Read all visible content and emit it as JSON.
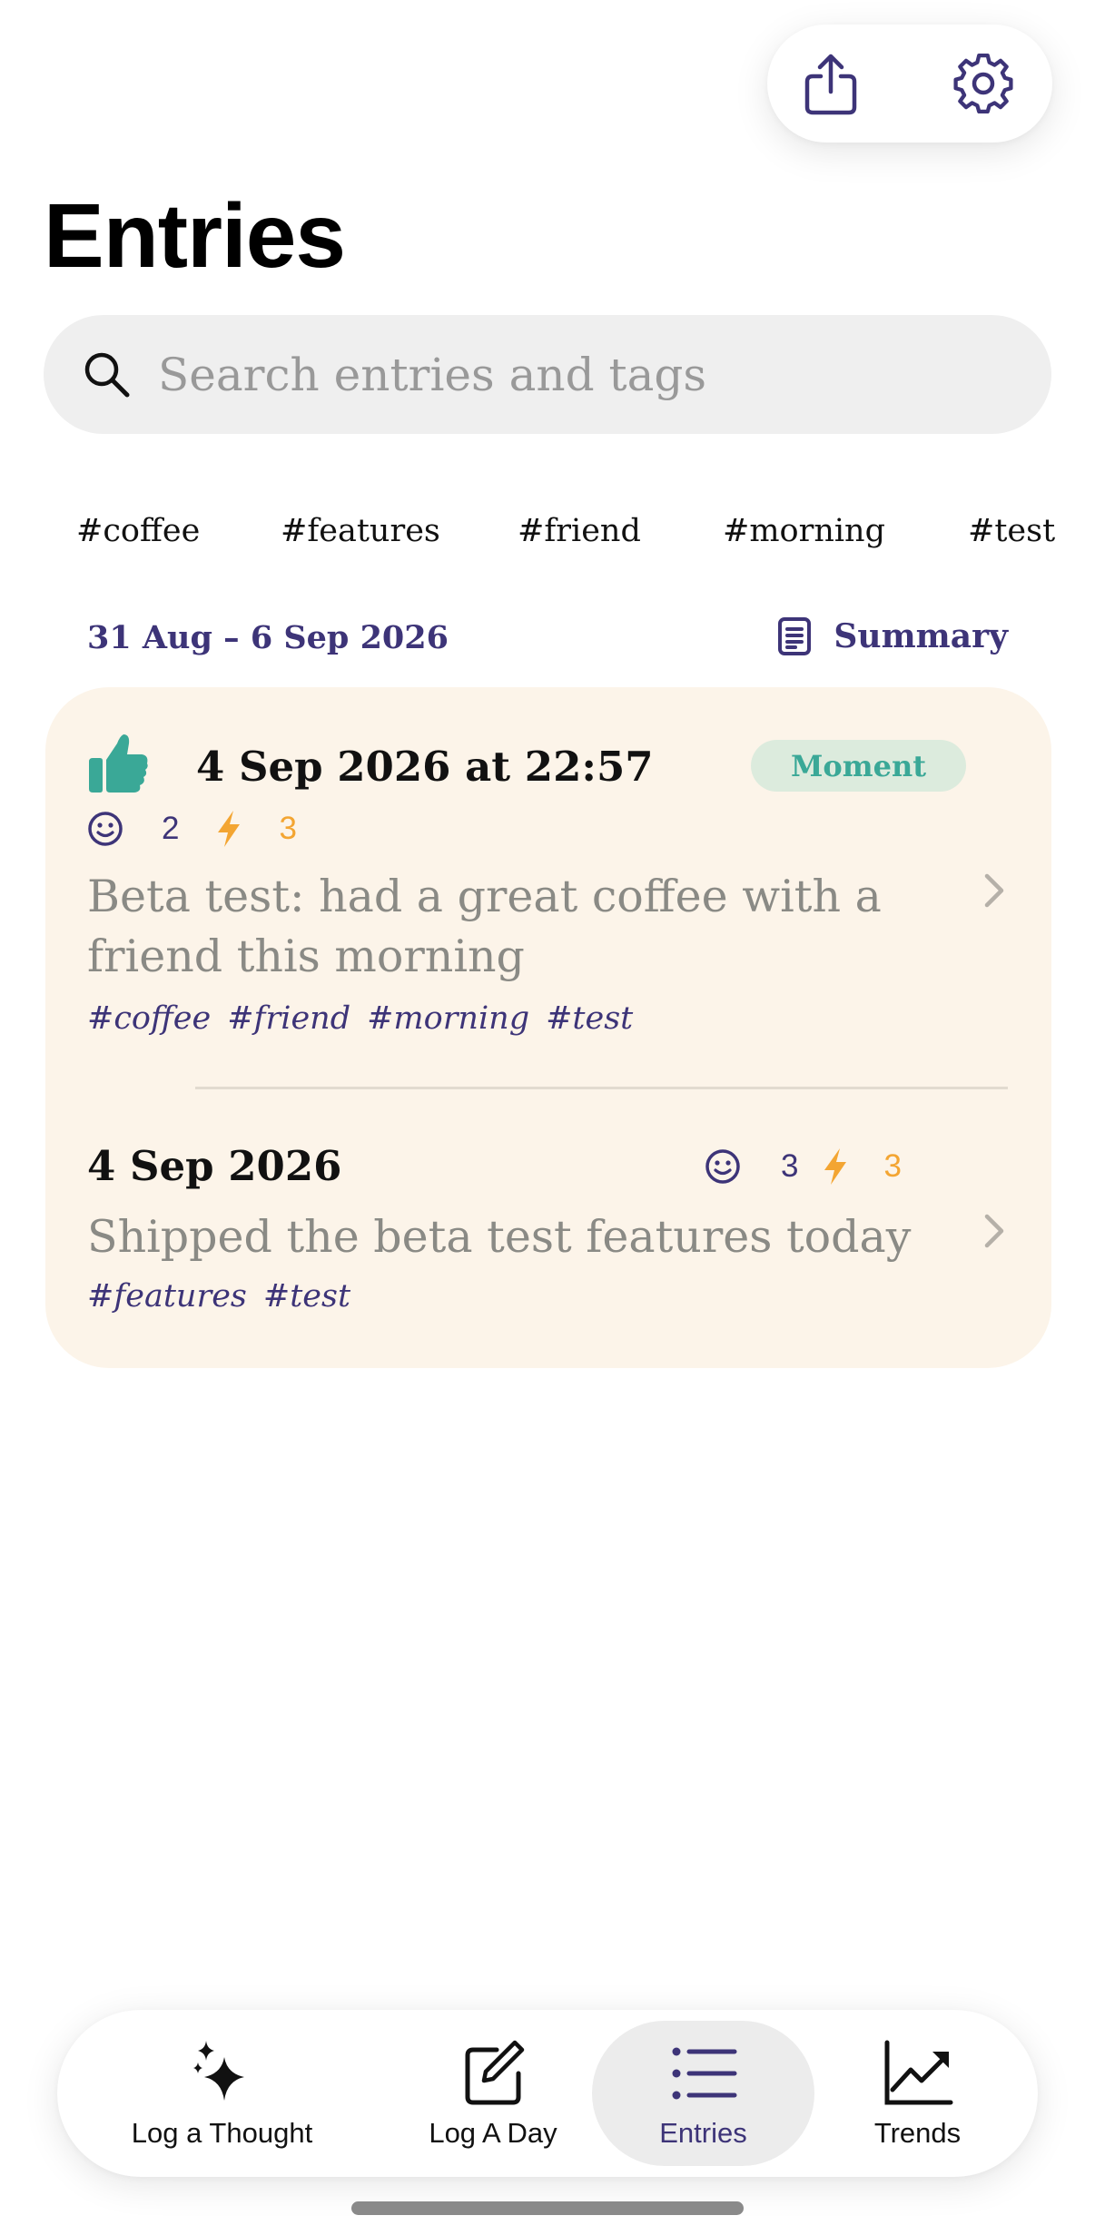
{
  "header": {
    "title": "Entries",
    "share_icon": "share-icon",
    "settings_icon": "gear-icon"
  },
  "search": {
    "placeholder": "Search entries and tags",
    "value": ""
  },
  "tag_filters": [
    "#coffee",
    "#features",
    "#friend",
    "#morning",
    "#test"
  ],
  "week": {
    "range": "31 Aug – 6 Sep 2026",
    "summary_label": "Summary"
  },
  "entries": [
    {
      "icon": "thumbs-up-icon",
      "date": "4 Sep 2026 at 22:57",
      "badge": "Moment",
      "mood": "2",
      "energy": "3",
      "text": "Beta test: had a great coffee with a friend this morning",
      "tags": [
        "#coffee",
        "#friend",
        "#morning",
        "#test"
      ]
    },
    {
      "date": "4 Sep 2026",
      "mood": "3",
      "energy": "3",
      "text": "Shipped the beta test features today",
      "tags": [
        "#features",
        "#test"
      ]
    }
  ],
  "tabbar": {
    "items": [
      {
        "label": "Log a Thought",
        "icon": "sparkles-icon"
      },
      {
        "label": "Log A Day",
        "icon": "compose-icon"
      },
      {
        "label": "Entries",
        "icon": "list-icon",
        "active": true
      },
      {
        "label": "Trends",
        "icon": "chart-icon"
      }
    ]
  },
  "colors": {
    "accent": "#3d3478",
    "energy": "#f3a532",
    "moment_badge_text": "#3aa897",
    "card_bg": "#fcf4e9"
  }
}
